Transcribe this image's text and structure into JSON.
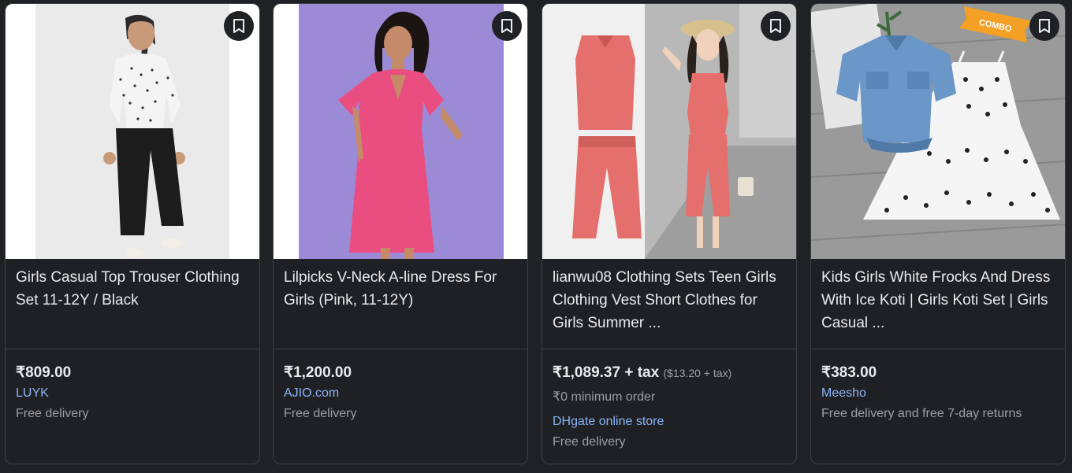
{
  "products": [
    {
      "title": "Girls Casual Top Trouser Clothing Set 11-12Y / Black",
      "price": "₹809.00",
      "store": "LUYK",
      "delivery": "Free delivery"
    },
    {
      "title": "Lilpicks V-Neck A-line Dress For Girls (Pink, 11-12Y)",
      "price": "₹1,200.00",
      "store": "AJIO.com",
      "delivery": "Free delivery"
    },
    {
      "title": "lianwu08 Clothing Sets Teen Girls Clothing Vest Short Clothes for Girls Summer ...",
      "price": "₹1,089.37 + tax",
      "price_secondary": "($13.20 + tax)",
      "min_order": "₹0 minimum order",
      "store": "DHgate online store",
      "delivery": "Free delivery"
    },
    {
      "title": "Kids Girls White Frocks And Dress With Ice Koti | Girls Koti Set | Girls Casual ...",
      "price": "₹383.00",
      "store": "Meesho",
      "delivery": "Free delivery and free 7-day returns",
      "image_badge": "COMBO"
    }
  ],
  "icons": {
    "bookmark": "bookmark-icon"
  },
  "colors": {
    "background": "#202124",
    "text": "#e8eaed",
    "muted": "#9aa0a6",
    "link": "#8ab4f8"
  }
}
